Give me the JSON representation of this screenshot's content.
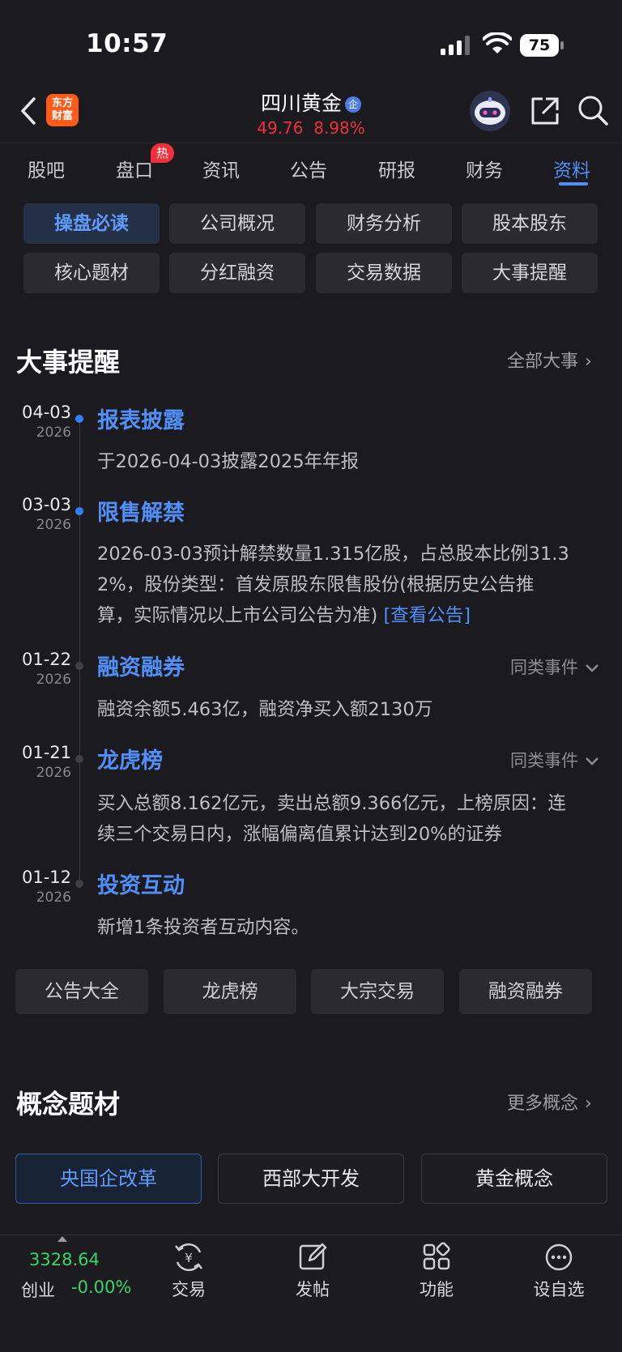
{
  "status_bar": {
    "time": "10:57",
    "battery": "75"
  },
  "header": {
    "logo_text": "东方财富",
    "stock_name": "四川黄金",
    "badge": "企",
    "price": "49.76",
    "change": "8.98%"
  },
  "tabs": [
    {
      "label": "股吧"
    },
    {
      "label": "盘口",
      "badge": "热"
    },
    {
      "label": "资讯"
    },
    {
      "label": "公告"
    },
    {
      "label": "研报"
    },
    {
      "label": "财务"
    },
    {
      "label": "资料"
    }
  ],
  "chips": [
    "操盘必读",
    "公司概况",
    "财务分析",
    "股本股东",
    "核心题材",
    "分红融资",
    "交易数据",
    "大事提醒"
  ],
  "events_section": {
    "title": "大事提醒",
    "more": "全部大事"
  },
  "events": [
    {
      "date": "04-03",
      "year": "2026",
      "title": "报表披露",
      "desc": "于2026-04-03披露2025年年报"
    },
    {
      "date": "03-03",
      "year": "2026",
      "title": "限售解禁",
      "desc_lines": [
        "2026-03-03预计解禁数量1.315亿股，占总股本比例31.3",
        "2%，股份类型：首发原股东限售股份(根据历史公告推",
        "算，实际情况以上市公司公告为准)"
      ],
      "link": "[查看公告]"
    },
    {
      "date": "01-22",
      "year": "2026",
      "title": "融资融券",
      "same": "同类事件",
      "desc": "融资余额5.463亿，融资净买入额2130万"
    },
    {
      "date": "01-21",
      "year": "2026",
      "title": "龙虎榜",
      "same": "同类事件",
      "desc_lines": [
        "买入总额8.162亿元，卖出总额9.366亿元，上榜原因：连",
        "续三个交易日内，涨幅偏离值累计达到20%的证券"
      ]
    },
    {
      "date": "01-12",
      "year": "2026",
      "title": "投资互动",
      "desc": "新增1条投资者互动内容。"
    }
  ],
  "quick_buttons": [
    "公告大全",
    "龙虎榜",
    "大宗交易",
    "融资融券"
  ],
  "concept_section": {
    "title": "概念题材",
    "more": "更多概念"
  },
  "concepts": [
    "央国企改革",
    "西部大开发",
    "黄金概念"
  ],
  "bottom_bar": {
    "index_value": "3328.64",
    "index_name": "创业",
    "index_change": "-0.00%",
    "nav": [
      "交易",
      "发帖",
      "功能",
      "设自选"
    ]
  },
  "colors": {
    "accent": "#4f8ff7",
    "up": "#f0313a",
    "down": "#3ad26a",
    "brand": "#ff5a17"
  }
}
